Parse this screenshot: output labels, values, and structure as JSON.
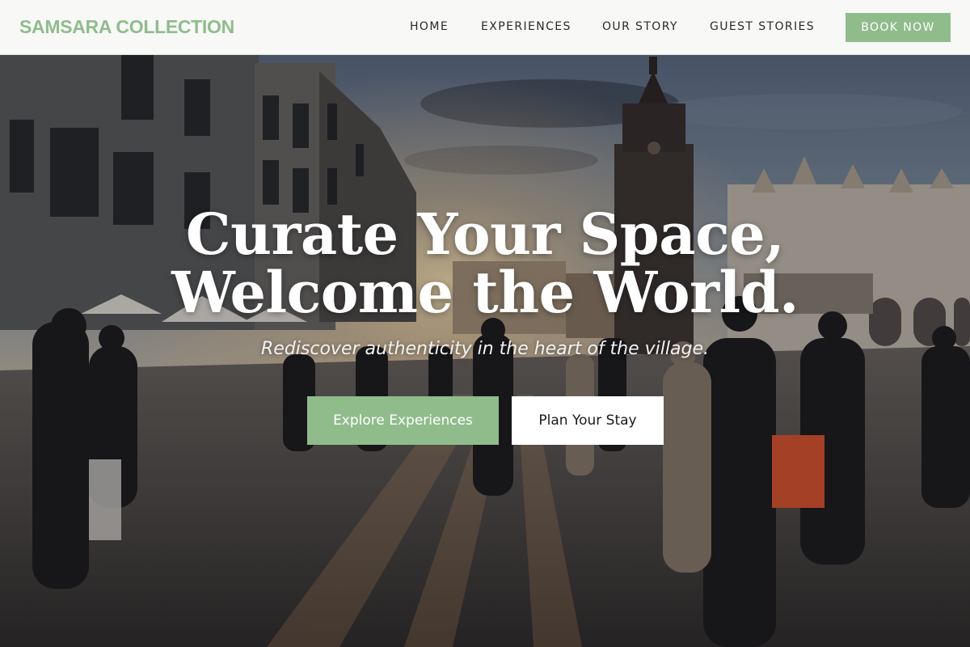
{
  "brand": {
    "name": "SAMSARA COLLECTION",
    "accent_color": "#90bc8c"
  },
  "nav": {
    "items": [
      {
        "label": "HOME"
      },
      {
        "label": "EXPERIENCES"
      },
      {
        "label": "OUR STORY"
      },
      {
        "label": "GUEST STORIES"
      }
    ],
    "book_label": "BOOK NOW"
  },
  "hero": {
    "headline_line1": "Curate Your Space,",
    "headline_line2": "Welcome the World.",
    "subheadline": "Rediscover authenticity in the heart of the village.",
    "primary_cta": "Explore Experiences",
    "secondary_cta": "Plan Your Stay",
    "background_image": "old-town-market-square-at-sunset"
  }
}
